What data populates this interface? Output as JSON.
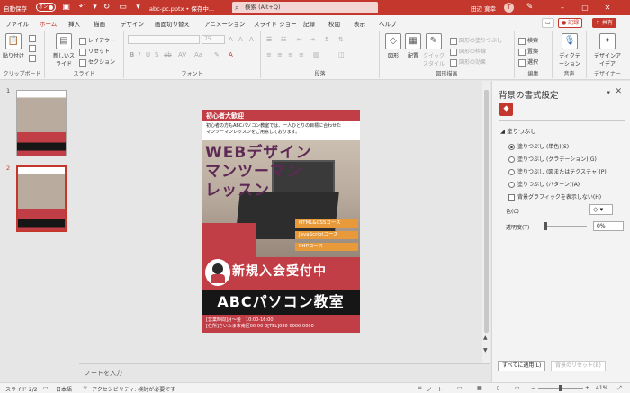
{
  "titlebar": {
    "autosave": "自動保存",
    "autosave_state": "オン",
    "doc_name": "abc-pc.pptx • 保存中...",
    "search_placeholder": "検索 (Alt+Q)",
    "user": "田辺 寛幸",
    "avatar": "T"
  },
  "tabs": [
    "ファイル",
    "ホーム",
    "挿入",
    "描画",
    "デザイン",
    "画面切り替え",
    "アニメーション",
    "スライド ショー",
    "記録",
    "校閲",
    "表示",
    "ヘルプ"
  ],
  "active_tab": "ホーム",
  "ribbon_right": {
    "record": "記録",
    "share": "共有"
  },
  "ribbon": {
    "clipboard": {
      "paste": "貼り付け",
      "label": "クリップボード"
    },
    "slides": {
      "new_slide": "新しいスライド",
      "layout": "レイアウト",
      "reset": "リセット",
      "section": "セクション",
      "label": "スライド"
    },
    "font": {
      "size": "75",
      "label": "フォント"
    },
    "paragraph": {
      "label": "段落"
    },
    "drawing": {
      "shapes": "図形",
      "arrange": "配置",
      "quick_styles": "クイックスタイル",
      "fill": "図形の塗りつぶし",
      "outline": "図形の枠線",
      "effects": "図形の効果",
      "label": "図形描画"
    },
    "editing": {
      "find": "検索",
      "replace": "置換",
      "select": "選択",
      "label": "編集"
    },
    "voice": {
      "dictate": "ディクテーション",
      "label": "音声"
    },
    "designer": {
      "label": "デザイナー",
      "ideas": "デザインアイデア"
    }
  },
  "slide": {
    "header": "初心者大歓迎",
    "intro_line1": "初心者の方もABCパソコン教室では、一人ひとりの目標に合わせた",
    "intro_line2": "マンツーマンレッスンをご用意しております。",
    "title": "WEBデザイン\nマンツーマン\nレッスン",
    "courses": [
      "HTML&CSSコース",
      "JavaScriptコース",
      "PHPコース"
    ],
    "banner": "新規入会受付中",
    "school": "ABCパソコン教室",
    "info1": "[営業時間]月～金　10:00-16:00",
    "info2": "[住所]さいたま市南区00-00-0[TEL]080-0000-0000"
  },
  "thumbs": [
    {
      "num": "1"
    },
    {
      "num": "2"
    }
  ],
  "notes_placeholder": "ノートを入力",
  "format_pane": {
    "title": "背景の書式設定",
    "section": "塗りつぶし",
    "options": [
      "塗りつぶし (単色)(S)",
      "塗りつぶし (グラデーション)(G)",
      "塗りつぶし (図またはテクスチャ)(P)",
      "塗りつぶし (パターン)(A)"
    ],
    "selected": 0,
    "hide_graphics": "背景グラフィックを表示しない(H)",
    "color_label": "色(C)",
    "transparency_label": "透明度(T)",
    "transparency": "0%",
    "apply_all": "すべてに適用(L)",
    "reset_bg": "背景のリセット(B)"
  },
  "statusbar": {
    "slide": "スライド 2/2",
    "lang": "日本語",
    "accessibility": "アクセシビリティ: 検討が必要です",
    "notes": "ノート",
    "zoom": "41%"
  }
}
